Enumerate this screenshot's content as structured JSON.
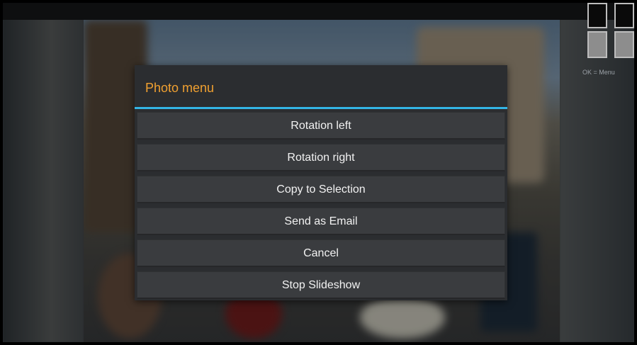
{
  "indicator": {
    "hint_text": "OK = Menu"
  },
  "dialog": {
    "title": "Photo menu",
    "accent_color": "#33b5e5",
    "title_color": "#f0a030",
    "items": [
      {
        "label": "Rotation left"
      },
      {
        "label": "Rotation right"
      },
      {
        "label": "Copy to Selection"
      },
      {
        "label": "Send as Email"
      },
      {
        "label": "Cancel"
      },
      {
        "label": "Stop Slideshow"
      }
    ]
  }
}
